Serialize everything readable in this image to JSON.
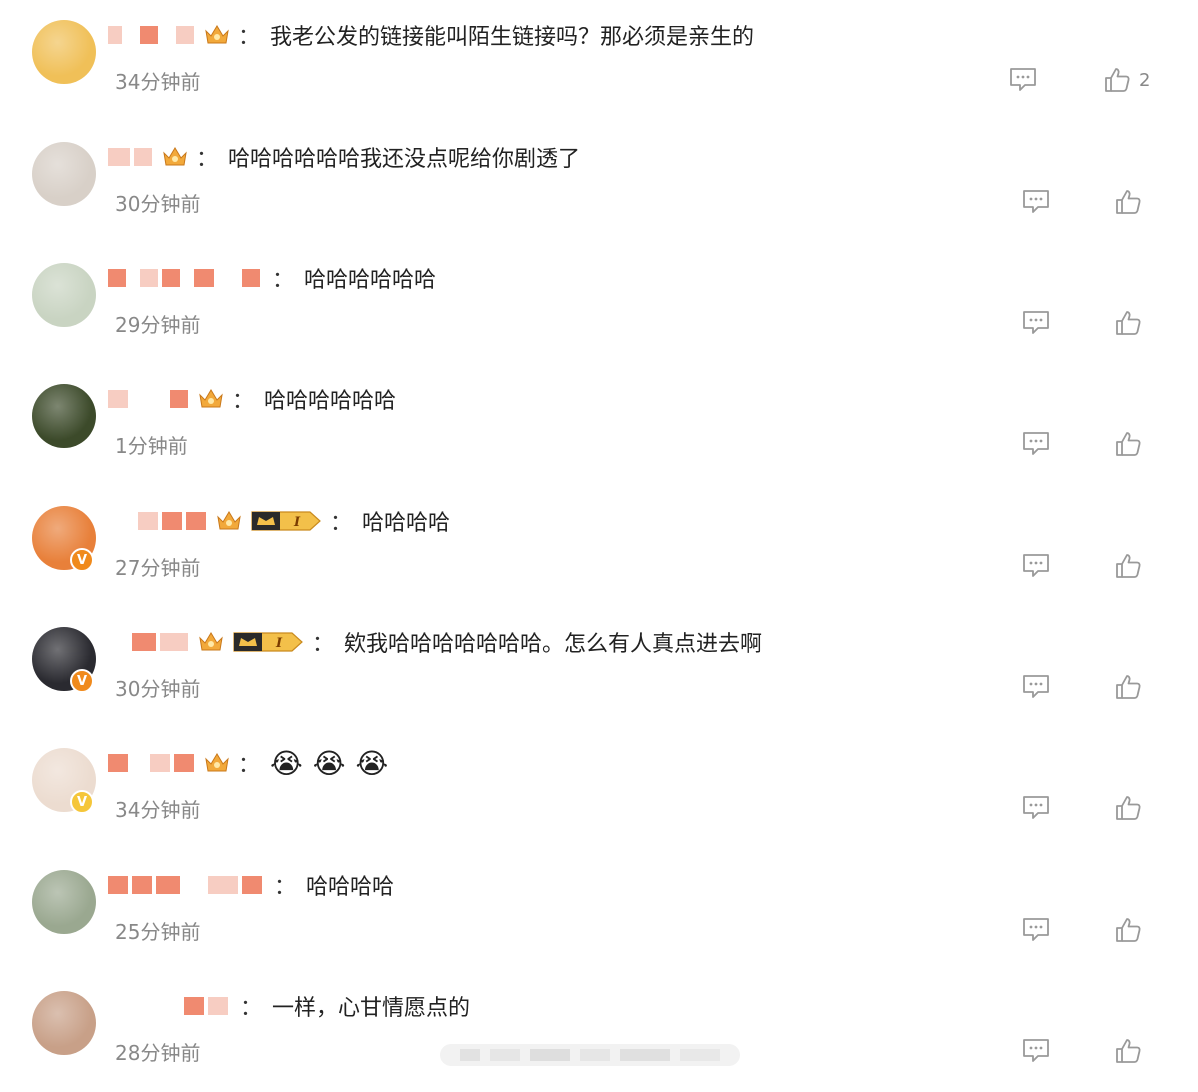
{
  "comments": [
    {
      "time": "34分钟前",
      "text": "我老公发的链接能叫陌生链接吗？那必须是亲生的",
      "separator": "：",
      "likes": "2",
      "avatar_color": "#f0c058",
      "verified": false
    },
    {
      "time": "30分钟前",
      "text": "哈哈哈哈哈哈我还没点呢给你剧透了",
      "separator": "：",
      "likes": "",
      "avatar_color": "#d8d0c8",
      "verified": false
    },
    {
      "time": "29分钟前",
      "text": "哈哈哈哈哈哈",
      "separator": "：",
      "likes": "",
      "avatar_color": "#c9d4c2",
      "verified": false
    },
    {
      "time": "1分钟前",
      "text": "哈哈哈哈哈哈",
      "separator": "：",
      "likes": "",
      "avatar_color": "#3c4a2a",
      "verified": false
    },
    {
      "time": "27分钟前",
      "text": "哈哈哈哈",
      "separator": "：",
      "likes": "",
      "avatar_color": "#e8803a",
      "verified": true,
      "verify_color": "#f08a1c",
      "level_badge": "I"
    },
    {
      "time": "30分钟前",
      "text": "欸我哈哈哈哈哈哈哈。怎么有人真点进去啊",
      "separator": "：",
      "likes": "",
      "avatar_color": "#2a2a30",
      "verified": true,
      "verify_color": "#f08a1c",
      "level_badge": "I"
    },
    {
      "time": "34分钟前",
      "text": "",
      "emojis": [
        "😭",
        "😭",
        "😭"
      ],
      "separator": "：",
      "likes": "",
      "avatar_color": "#ecdcd0",
      "verified": true,
      "verify_color": "#f5c63a"
    },
    {
      "time": "25分钟前",
      "text": "哈哈哈哈",
      "separator": "：",
      "likes": "",
      "avatar_color": "#9aa890",
      "verified": false
    },
    {
      "time": "28分钟前",
      "text": "一样，心甘情愿点的",
      "separator": "：",
      "likes": "",
      "avatar_color": "#c8a088",
      "verified": false
    }
  ],
  "colors": {
    "mosaic_dark": "#f08a70",
    "mosaic_light": "#f7cdc2",
    "icon_gray": "#999999",
    "crown_gold": "#f2a93b"
  },
  "icons": {
    "reply": "comment-bubble-icon",
    "like": "thumbs-up-icon",
    "crown": "crown-icon"
  }
}
